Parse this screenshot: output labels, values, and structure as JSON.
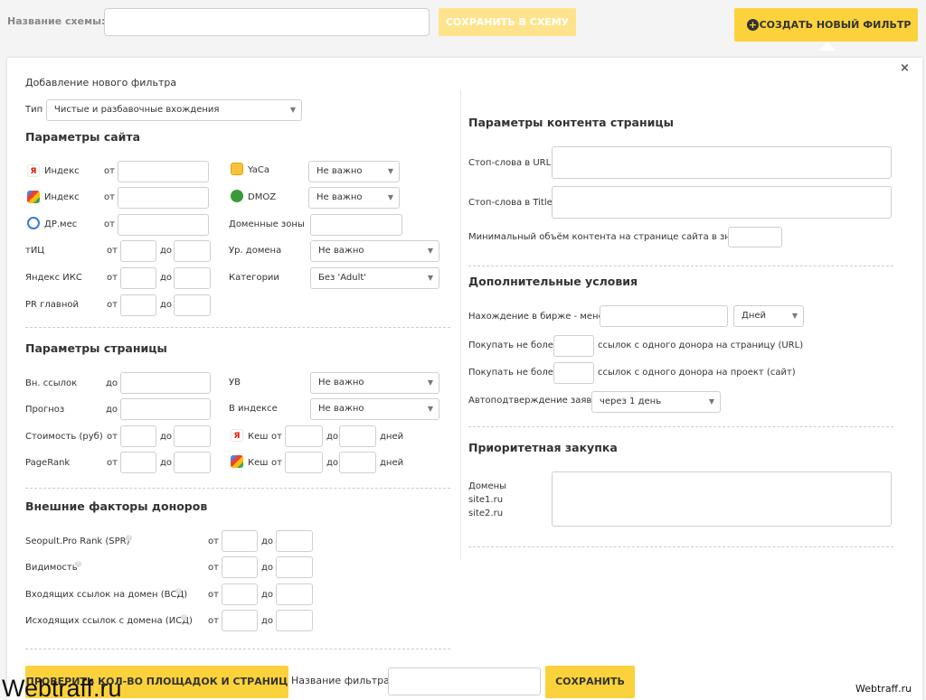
{
  "header": {
    "scheme_label": "Название схемы:",
    "scheme_value": "",
    "save_to_scheme": "СОХРАНИТЬ В СХЕМУ",
    "create_filter": "СОЗДАТЬ НОВЫЙ ФИЛЬТР"
  },
  "panel": {
    "close": "×",
    "title": "Добавление нового фильтра",
    "type_label": "Тип",
    "type_value": "Чистые и разбавочные вхождения"
  },
  "site": {
    "title": "Параметры сайта",
    "ot": "от",
    "do": "до",
    "ya_index": "Индекс",
    "g_index": "Индекс",
    "dp": "ДР.мес",
    "tic": "тИЦ",
    "iks": "Яндекс ИКС",
    "pr": "PR главной",
    "yaca": "YaCa",
    "yaca_val": "Не важно",
    "dmoz": "DMOZ",
    "dmoz_val": "Не важно",
    "zones": "Доменные зоны",
    "level": "Ур. домена",
    "level_val": "Не важно",
    "cat": "Категории",
    "cat_val": "Без 'Adult'"
  },
  "page": {
    "title": "Параметры страницы",
    "out_links": "Вн. ссылок",
    "forecast": "Прогноз",
    "cost": "Стоимость (руб)",
    "pagerank": "PageRank",
    "uv": "УВ",
    "uv_val": "Не важно",
    "in_index": "В индексе",
    "in_index_val": "Не важно",
    "cache": "Кеш",
    "days": "дней"
  },
  "external": {
    "title": "Внешние факторы доноров",
    "spr": "Seopult.Pro Rank (SPR)",
    "vis": "Видимость",
    "vsd": "Входящих ссылок на домен (ВСД)",
    "isd": "Исходящих ссылок с домена (ИСД)"
  },
  "content": {
    "title": "Параметры контента страницы",
    "stop_url": "Стоп-слова в URL",
    "stop_title": "Стоп-слова в Title",
    "min_volume": "Минимальный объём контента на странице сайта в знаках"
  },
  "additional": {
    "title": "Дополнительные условия",
    "exchange": "Нахождение в бирже - менее",
    "exchange_unit": "Дней",
    "buy_page_pre": "Покупать не более",
    "buy_page_post": "ссылок с одного донора на страницу (URL)",
    "buy_site_pre": "Покупать не более",
    "buy_site_post": "ссылок с одного донора на проект (сайт)",
    "auto": "Автоподтверждение заявок",
    "auto_val": "через 1 день"
  },
  "priority": {
    "title": "Приоритетная закупка",
    "domains_label": "Домены",
    "ex1": "site1.ru",
    "ex2": "site2.ru"
  },
  "footer": {
    "check": "ПРОВЕРИТЬ КОЛ-ВО ПЛОЩАДОК И СТРАНИЦ",
    "filter_name": "Название фильтра",
    "save": "СОХРАНИТЬ"
  },
  "watermark": {
    "left": "Webtraff.ru",
    "right": "Webtraff.ru"
  }
}
